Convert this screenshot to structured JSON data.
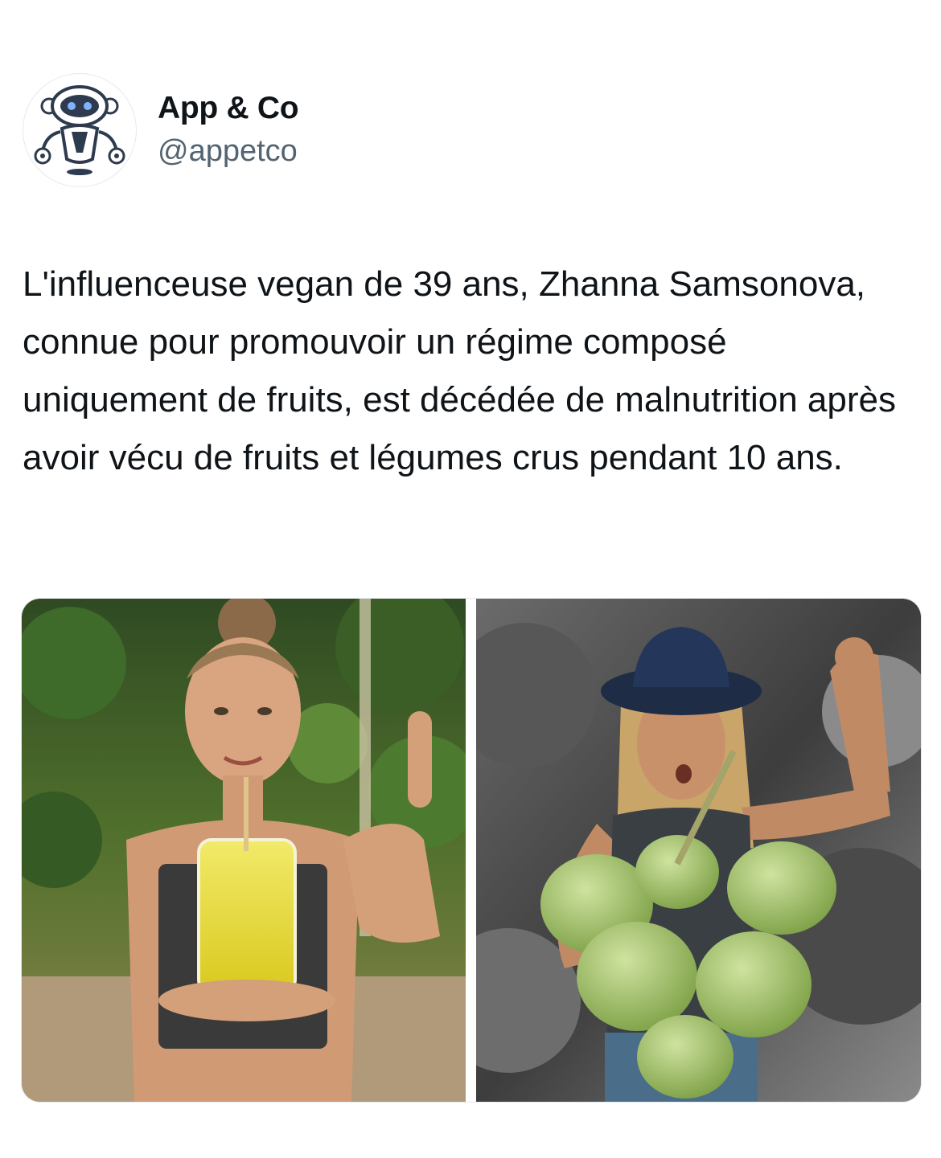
{
  "tweet": {
    "author": {
      "display_name": "App & Co",
      "handle": "@appetco",
      "avatar_icon": "robot-mascot-icon"
    },
    "text": "L'influenceuse vegan de 39 ans, Zhanna Samsonova, connue pour promouvoir un régime composé uniquement de fruits, est décédée de malnutrition après avoir vécu de fruits et légumes crus pendant 10 ans.",
    "media": {
      "count": 2,
      "photos": [
        {
          "content": "woman holding glass of yellow juice giving thumbs up in jungle"
        },
        {
          "content": "woman in blue hat flexing arm holding green coconuts, black and white background"
        }
      ]
    }
  }
}
